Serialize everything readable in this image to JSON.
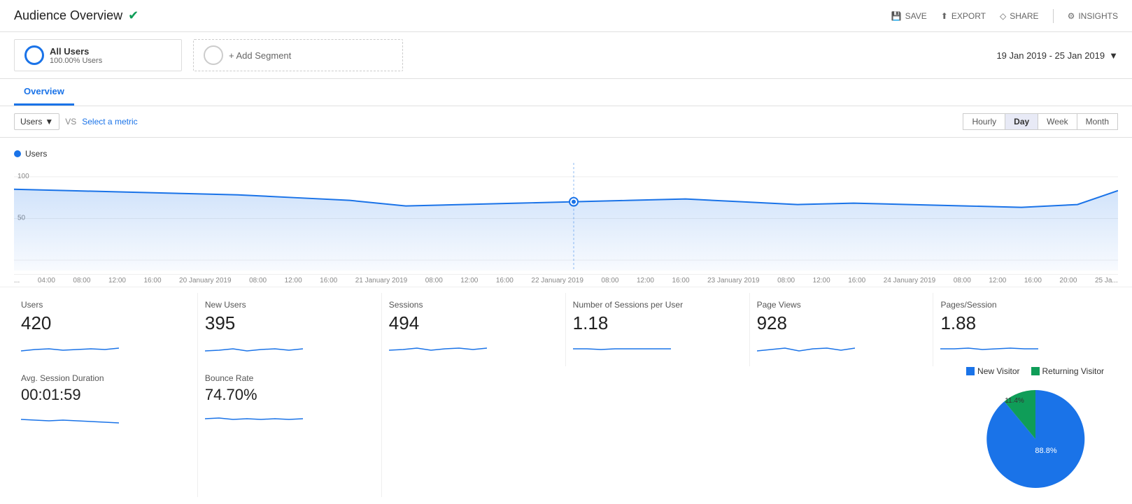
{
  "header": {
    "title": "Audience Overview",
    "check_icon": "✔",
    "actions": [
      {
        "label": "SAVE",
        "icon": "💾"
      },
      {
        "label": "EXPORT",
        "icon": "⬆"
      },
      {
        "label": "SHARE",
        "icon": "⬡"
      },
      {
        "label": "INSIGHTS",
        "icon": "⚙"
      }
    ]
  },
  "segments": {
    "segment1": {
      "name": "All Users",
      "sub": "100.00% Users"
    },
    "add_label": "+ Add Segment"
  },
  "date_range": "19 Jan 2019 - 25 Jan 2019",
  "tabs": [
    {
      "label": "Overview",
      "active": true
    }
  ],
  "chart_controls": {
    "metric": "Users",
    "vs_label": "VS",
    "select_metric": "Select a metric",
    "time_buttons": [
      {
        "label": "Hourly",
        "active": false
      },
      {
        "label": "Day",
        "active": true
      },
      {
        "label": "Week",
        "active": false
      },
      {
        "label": "Month",
        "active": false
      }
    ]
  },
  "chart": {
    "legend_label": "Users",
    "y_labels": [
      "100",
      "50"
    ],
    "x_labels": [
      "...",
      "04:00",
      "08:00",
      "12:00",
      "16:00",
      "20 January 2019",
      "08:00",
      "12:00",
      "16:00",
      "21 January 2019",
      "08:00",
      "12:00",
      "16:00",
      "22 January 2019",
      "08:00",
      "12:00",
      "16:00",
      "23 January 2019",
      "08:00",
      "12:00",
      "16:00",
      "24 January 2019",
      "08:00",
      "12:00",
      "16:00",
      "20:00",
      "25 Ja..."
    ]
  },
  "metrics": [
    {
      "label": "Users",
      "value": "420"
    },
    {
      "label": "New Users",
      "value": "395"
    },
    {
      "label": "Sessions",
      "value": "494"
    },
    {
      "label": "Number of Sessions per User",
      "value": "1.18"
    },
    {
      "label": "Page Views",
      "value": "928"
    },
    {
      "label": "Pages/Session",
      "value": "1.88"
    }
  ],
  "bottom_metrics": [
    {
      "label": "Avg. Session Duration",
      "value": "00:01:59"
    },
    {
      "label": "Bounce Rate",
      "value": "74.70%"
    }
  ],
  "pie": {
    "legend": [
      {
        "label": "New Visitor",
        "color": "#1a73e8"
      },
      {
        "label": "Returning Visitor",
        "color": "#0F9D58"
      }
    ],
    "segments": [
      {
        "label": "88.8%",
        "value": 88.8,
        "color": "#1a73e8"
      },
      {
        "label": "11.4%",
        "value": 11.4,
        "color": "#0F9D58"
      }
    ]
  }
}
